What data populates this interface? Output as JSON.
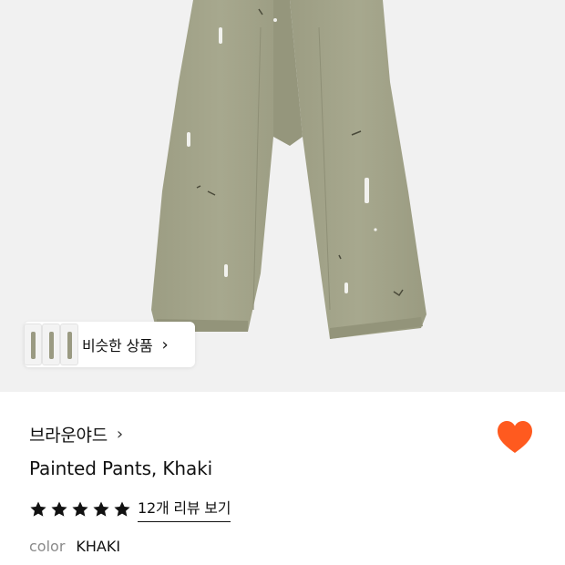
{
  "similar": {
    "label": "비슷한 상품",
    "chevron": "›"
  },
  "product": {
    "brand": "브라운야드",
    "brand_chevron": "›",
    "name": "Painted Pants, Khaki",
    "rating_stars": 5,
    "review_link": "12개 리뷰 보기",
    "color_label": "color",
    "color_value": "KHAKI"
  },
  "icons": {
    "favorite": "heart-icon",
    "star": "star-icon",
    "chevron": "chevron-right-icon"
  },
  "colors": {
    "heart": "#ff5a1f",
    "pants": "#a3a48a",
    "background": "#f1f1f1"
  }
}
